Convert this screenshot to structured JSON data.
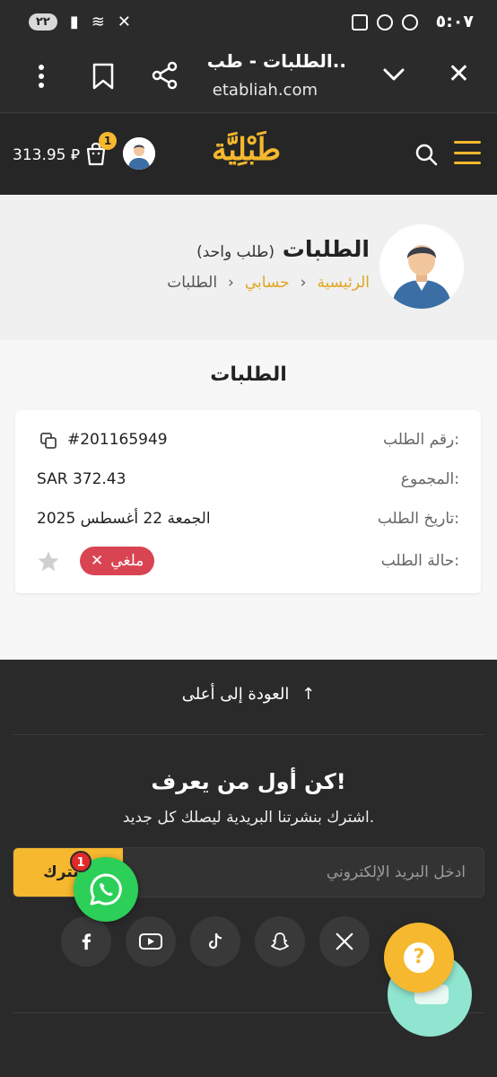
{
  "status_bar": {
    "time": "٥:٠٧",
    "battery": "٢٢"
  },
  "browser": {
    "title": "الطلبات - طب..",
    "url": "etabliah.com"
  },
  "header": {
    "logo_text": "طَبْلِيَّة",
    "cart_count": "1",
    "balance": "313.95 ⃁"
  },
  "profile": {
    "title": "الطلبات",
    "subtitle": "(طلب واحد)",
    "breadcrumb": {
      "home": "الرئيسية",
      "account": "حسابي",
      "current": "الطلبات",
      "sep": "‹"
    }
  },
  "orders": {
    "heading": "الطلبات",
    "order": {
      "number_label": "رقم الطلب:",
      "number": "#201165949",
      "total_label": "المجموع:",
      "total": "SAR 372.43",
      "date_label": "تاريخ الطلب:",
      "date": "الجمعة 22 أغسطس 2025",
      "status_label": "حالة الطلب:",
      "status": "ملغي",
      "status_color": "#d94452"
    }
  },
  "footer": {
    "back_to_top": "العودة إلى أعلى",
    "newsletter_heading": "كن أول من يعرف!",
    "newsletter_sub": "اشترك بنشرتنا البريدية ليصلك كل جديد.",
    "email_placeholder": "ادخل البريد الإلكتروني",
    "subscribe_label": "اشترك",
    "socials": [
      "facebook-icon",
      "youtube-icon",
      "tiktok-icon",
      "snapchat-icon",
      "x-icon"
    ]
  },
  "whatsapp_badge": "1",
  "help_label": "?",
  "colors": {
    "accent": "#f5b82e",
    "dark": "#2a2a2a",
    "danger": "#d94452",
    "whatsapp": "#2ccf58",
    "chat": "#8fe5cf"
  }
}
